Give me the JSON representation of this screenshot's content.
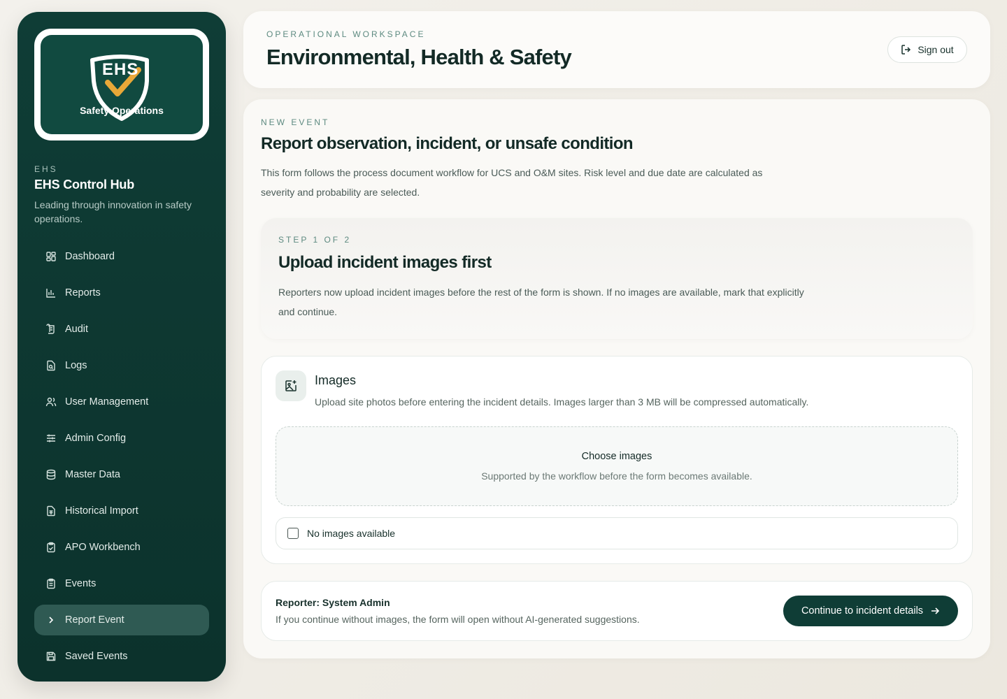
{
  "sidebar": {
    "logo": {
      "text_top": "EHS",
      "text_bottom": "Safety Operations"
    },
    "eyebrow": "EHS",
    "title": "EHS Control Hub",
    "tagline": "Leading through innovation in safety operations.",
    "items": [
      {
        "label": "Dashboard",
        "icon": "dashboard-icon"
      },
      {
        "label": "Reports",
        "icon": "bar-chart-icon"
      },
      {
        "label": "Audit",
        "icon": "scroll-icon"
      },
      {
        "label": "Logs",
        "icon": "file-search-icon"
      },
      {
        "label": "User Management",
        "icon": "users-icon"
      },
      {
        "label": "Admin Config",
        "icon": "sliders-icon"
      },
      {
        "label": "Master Data",
        "icon": "database-icon"
      },
      {
        "label": "Historical Import",
        "icon": "file-spreadsheet-icon"
      },
      {
        "label": "APO Workbench",
        "icon": "clipboard-check-icon"
      },
      {
        "label": "Events",
        "icon": "clipboard-list-icon"
      },
      {
        "label": "Report Event",
        "icon": "chevron-right-icon",
        "active": true
      },
      {
        "label": "Saved Events",
        "icon": "save-icon"
      }
    ]
  },
  "header": {
    "eyebrow": "OPERATIONAL WORKSPACE",
    "title": "Environmental, Health & Safety",
    "signout_label": "Sign out"
  },
  "main": {
    "eyebrow": "NEW EVENT",
    "title": "Report observation, incident, or unsafe condition",
    "description": "This form follows the process document workflow for UCS and O&M sites. Risk level and due date are calculated as severity and probability are selected.",
    "step": {
      "eyebrow": "STEP 1 OF 2",
      "title": "Upload incident images first",
      "description": "Reporters now upload incident images before the rest of the form is shown. If no images are available, mark that explicitly and continue."
    },
    "images": {
      "title": "Images",
      "description": "Upload site photos before entering the incident details. Images larger than 3 MB will be compressed automatically.",
      "dropzone_title": "Choose images",
      "dropzone_subtitle": "Supported by the workflow before the form becomes available.",
      "no_images_label": "No images available",
      "no_images_checked": false
    },
    "footer": {
      "reporter": "Reporter: System Admin",
      "note": "If you continue without images, the form will open without AI-generated suggestions.",
      "continue_label": "Continue to incident details"
    }
  },
  "colors": {
    "sidebar_bg": "#0f3d36",
    "accent": "#0f3d36",
    "logo_check": "#e8a838",
    "active_nav": "#2f5a53"
  }
}
